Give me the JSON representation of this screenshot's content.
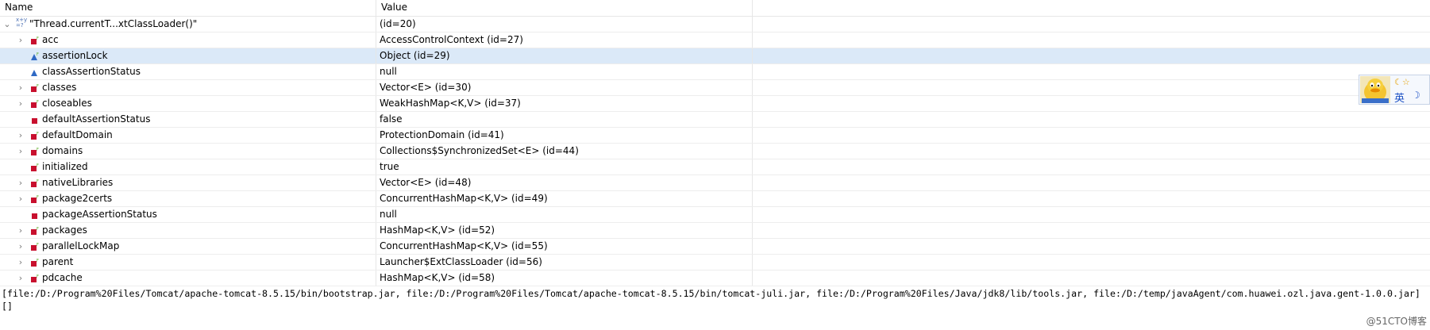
{
  "header": {
    "name": "Name",
    "value": "Value"
  },
  "root": {
    "label": "\"Thread.currentT...xtClassLoader()\"",
    "value": " (id=20)",
    "icon": "watch-expression-icon"
  },
  "rows": [
    {
      "name": "acc",
      "value": "AccessControlContext  (id=27)",
      "expandable": true,
      "icon": "final-field-icon"
    },
    {
      "name": "assertionLock",
      "value": "Object  (id=29)",
      "expandable": false,
      "icon": "protected-final-field-icon",
      "selected": true
    },
    {
      "name": "classAssertionStatus",
      "value": "null",
      "expandable": false,
      "icon": "protected-field-icon"
    },
    {
      "name": "classes",
      "value": "Vector<E>  (id=30)",
      "expandable": true,
      "icon": "final-field-icon"
    },
    {
      "name": "closeables",
      "value": "WeakHashMap<K,V>  (id=37)",
      "expandable": true,
      "icon": "final-field-icon"
    },
    {
      "name": "defaultAssertionStatus",
      "value": "false",
      "expandable": false,
      "icon": "private-field-icon"
    },
    {
      "name": "defaultDomain",
      "value": "ProtectionDomain  (id=41)",
      "expandable": true,
      "icon": "final-field-icon"
    },
    {
      "name": "domains",
      "value": "Collections$SynchronizedSet<E>  (id=44)",
      "expandable": true,
      "icon": "final-field-icon"
    },
    {
      "name": "initialized",
      "value": "true",
      "expandable": false,
      "icon": "final-field-icon"
    },
    {
      "name": "nativeLibraries",
      "value": "Vector<E>  (id=48)",
      "expandable": true,
      "icon": "final-field-icon"
    },
    {
      "name": "package2certs",
      "value": "ConcurrentHashMap<K,V>  (id=49)",
      "expandable": true,
      "icon": "final-field-icon"
    },
    {
      "name": "packageAssertionStatus",
      "value": "null",
      "expandable": false,
      "icon": "private-field-icon"
    },
    {
      "name": "packages",
      "value": "HashMap<K,V>  (id=52)",
      "expandable": true,
      "icon": "final-field-icon"
    },
    {
      "name": "parallelLockMap",
      "value": "ConcurrentHashMap<K,V>  (id=55)",
      "expandable": true,
      "icon": "final-field-icon"
    },
    {
      "name": "parent",
      "value": "Launcher$ExtClassLoader  (id=56)",
      "expandable": true,
      "icon": "final-field-icon"
    },
    {
      "name": "pdcache",
      "value": "HashMap<K,V>  (id=58)",
      "expandable": true,
      "icon": "final-field-icon"
    }
  ],
  "console": {
    "line1": "[file:/D:/Program%20Files/Tomcat/apache-tomcat-8.5.15/bin/bootstrap.jar, file:/D:/Program%20Files/Tomcat/apache-tomcat-8.5.15/bin/tomcat-juli.jar, file:/D:/Program%20Files/Java/jdk8/lib/tools.jar, file:/D:/temp/javaAgent/com.huawei.ozl.java.gent-1.0.0.jar]",
    "line2": "[]"
  },
  "ime": {
    "lang": "英",
    "moon_star": "☾☆",
    "moon": "☽"
  },
  "watermark": "@51CTO博客",
  "colors": {
    "selected_row": "#dbe9f8",
    "field_red": "#c8102e",
    "protected_blue": "#2f69c4"
  }
}
